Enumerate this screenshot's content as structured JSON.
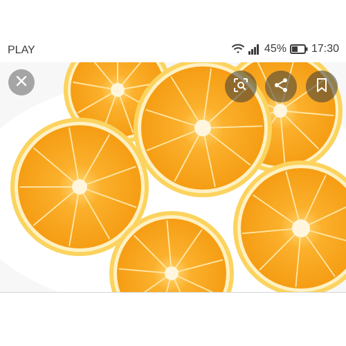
{
  "status_bar": {
    "carrier": "PLAY",
    "battery_percent": "45%",
    "time": "17:30",
    "icons": [
      "wifi-icon",
      "signal-icon",
      "battery-icon"
    ]
  },
  "viewer": {
    "image_subject": "orange-slices-photo",
    "buttons": [
      "close-icon",
      "lens-icon",
      "share-icon",
      "bookmark-icon"
    ]
  },
  "colors": {
    "orange_flesh": "#f8a21a",
    "orange_rind": "#f9c94a",
    "overlay_button": "#3c3c3c",
    "status_text": "#3a3a3a"
  }
}
